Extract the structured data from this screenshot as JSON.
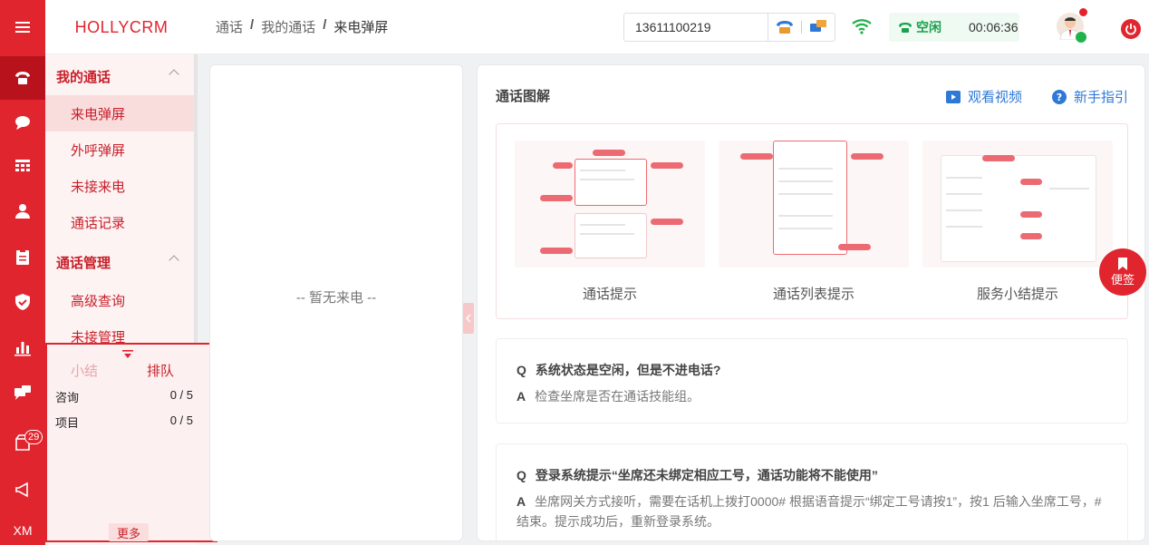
{
  "app": {
    "logo": "HOLLYCRM"
  },
  "breadcrumb": {
    "items": [
      "通话",
      "我的通话",
      "来电弹屏"
    ],
    "sep": "/"
  },
  "header": {
    "phone_value": "13611100219",
    "status_label": "空闲",
    "timer": "00:06:36"
  },
  "rail": {
    "badge": "29",
    "xm": "XM"
  },
  "sidebar": {
    "groups": [
      {
        "label": "我的通话",
        "items": [
          "来电弹屏",
          "外呼弹屏",
          "未接来电",
          "通话记录"
        ]
      },
      {
        "label": "通话管理",
        "items": [
          "高级查询",
          "未接管理"
        ]
      }
    ],
    "active_item": "来电弹屏"
  },
  "queue": {
    "tabs": [
      "小结",
      "排队"
    ],
    "rows": [
      {
        "name": "咨询",
        "value": "0 / 5"
      },
      {
        "name": "项目",
        "value": "0 / 5"
      }
    ],
    "more": "更多"
  },
  "middle": {
    "empty_text": "-- 暂无来电 --"
  },
  "content": {
    "title": "通话图解",
    "links": {
      "video": "观看视频",
      "guide": "新手指引"
    },
    "diagrams": [
      "通话提示",
      "通话列表提示",
      "服务小结提示"
    ],
    "faqs": [
      {
        "q_mark": "Q",
        "q": "系统状态是空闲，但是不进电话?",
        "a_mark": "A",
        "a": "检查坐席是否在通话技能组。"
      },
      {
        "q_mark": "Q",
        "q": "登录系统提示“坐席还未绑定相应工号，通话功能将不能使用”",
        "a_mark": "A",
        "a": "坐席网关方式接听，需要在话机上拨打0000# 根据语音提示“绑定工号请按1”，按1 后输入坐席工号，#结束。提示成功后，重新登录系统。"
      }
    ]
  },
  "float": {
    "label": "便签"
  },
  "colors": {
    "brand": "#e0252f",
    "status_green": "#1aa14a",
    "link_blue": "#2e78d6"
  }
}
